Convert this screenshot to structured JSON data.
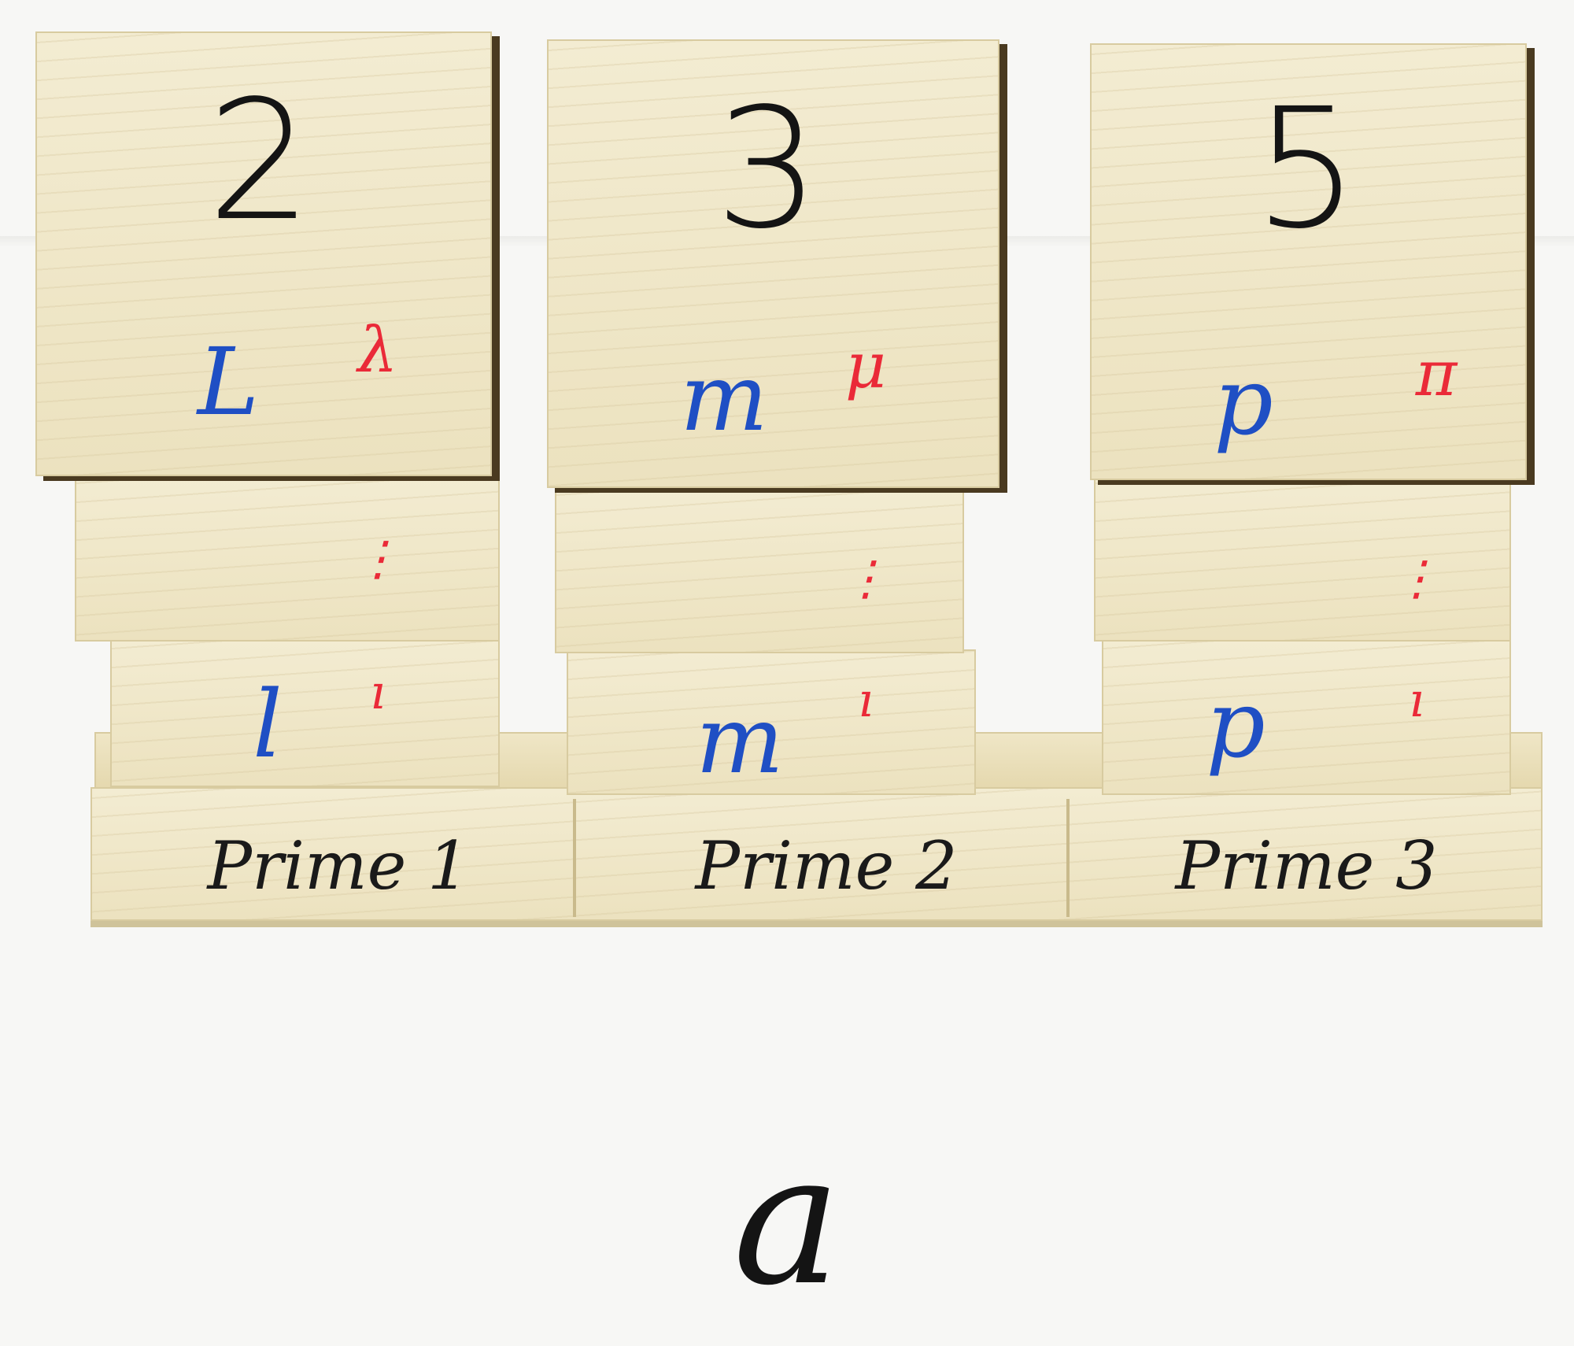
{
  "columns": [
    {
      "number": "2",
      "top_letter": "L",
      "top_symbol": "λ",
      "middle_marker": "⋮",
      "bottom_letter": "l",
      "bottom_symbol": "ı",
      "base_label": "Prime 1"
    },
    {
      "number": "3",
      "top_letter": "m",
      "top_symbol": "μ",
      "middle_marker": "⋮",
      "bottom_letter": "m",
      "bottom_symbol": "ı",
      "base_label": "Prime 2"
    },
    {
      "number": "5",
      "top_letter": "p",
      "top_symbol": "π",
      "middle_marker": "⋮",
      "bottom_letter": "p",
      "bottom_symbol": "ı",
      "base_label": "Prime 3"
    }
  ],
  "caption": "a",
  "colors": {
    "ink_black": "#141414",
    "ink_blue": "#1f4fc4",
    "ink_red": "#ea2a38",
    "wood": "#ece2bf"
  }
}
